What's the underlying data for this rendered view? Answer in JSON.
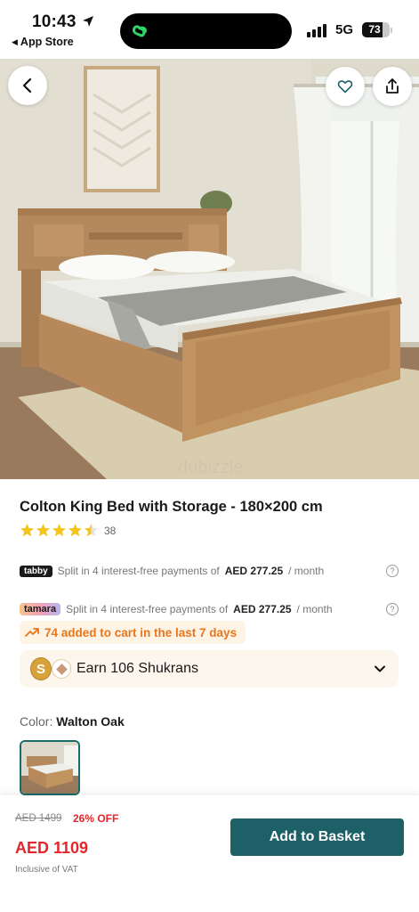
{
  "status_bar": {
    "time": "10:43",
    "back_app": "App Store",
    "network": "5G",
    "battery": "73",
    "battery_level": 0.73
  },
  "product": {
    "title": "Colton King Bed with Storage - 180×200 cm",
    "rating": 4.5,
    "rating_count": "38"
  },
  "payments": [
    {
      "provider": "tabby",
      "text": "Split in 4 interest-free payments of",
      "amount": "AED 277.25",
      "suffix": "/ month"
    },
    {
      "provider": "tamara",
      "text": "Split in 4 interest-free payments of",
      "amount": "AED 277.25",
      "suffix": "/ month"
    }
  ],
  "cart_badge": "74 added to cart in the last 7 days",
  "shukran": {
    "coin_letter": "S",
    "text": "Earn 106 Shukrans"
  },
  "color": {
    "label": "Color:",
    "value": "Walton Oak"
  },
  "pricing": {
    "old_price": "AED 1499",
    "discount": "26% OFF",
    "price": "AED 1109",
    "vat_note": "Inclusive of VAT",
    "add_button": "Add to Basket"
  },
  "colors": {
    "accent": "#1d6068",
    "sale_red": "#e3262b",
    "badge_orange": "#e8761c",
    "star_yellow": "#f5c518"
  },
  "icons": [
    "location-arrow-icon",
    "back-chevron-icon",
    "heart-icon",
    "share-icon",
    "info-icon",
    "trend-up-icon",
    "chevron-down-icon",
    "star-icon"
  ]
}
